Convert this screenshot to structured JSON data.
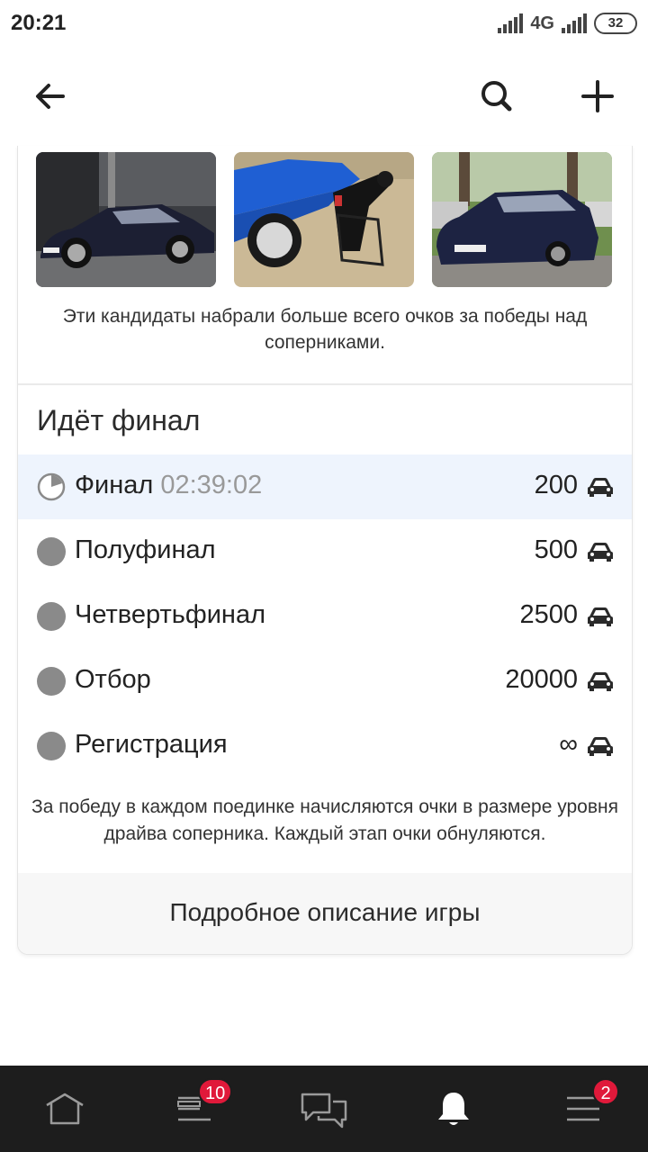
{
  "status_bar": {
    "time": "20:21",
    "network": "4G",
    "battery": "32"
  },
  "app_bar": {
    "icons": [
      "back-arrow-icon",
      "search-icon",
      "plus-icon"
    ]
  },
  "leaders": {
    "photos": [
      {
        "subject": "dark BMW coupe near garage"
      },
      {
        "subject": "blue car with person in chair"
      },
      {
        "subject": "dark BMW sedan in parking"
      }
    ],
    "caption": "Эти кандидаты набрали больше всего очков за победы над соперниками."
  },
  "final_section": {
    "title": "Идёт финал",
    "stages": [
      {
        "name": "Финал",
        "timer": "02:39:02",
        "points": "200",
        "active": true
      },
      {
        "name": "Полуфинал",
        "timer": "",
        "points": "500",
        "active": false
      },
      {
        "name": "Четвертьфинал",
        "timer": "",
        "points": "2500",
        "active": false
      },
      {
        "name": "Отбор",
        "timer": "",
        "points": "20000",
        "active": false
      },
      {
        "name": "Регистрация",
        "timer": "",
        "points": "∞",
        "active": false
      }
    ],
    "rules_text": "За победу в каждом поединке начисляются очки в размере уровня драйва соперника. Каждый этап очки обнуляются.",
    "details_button": "Подробное описание игры"
  },
  "bottom_nav": {
    "items": [
      {
        "icon": "home-icon",
        "badge": ""
      },
      {
        "icon": "feed-icon",
        "badge": "10"
      },
      {
        "icon": "messages-icon",
        "badge": ""
      },
      {
        "icon": "bell-icon",
        "badge": ""
      },
      {
        "icon": "menu-icon",
        "badge": "2"
      }
    ]
  },
  "colors": {
    "active_row": "#eef4fd",
    "badge": "#e0193a",
    "nav_bg": "#1d1d1d",
    "dot": "#8a8a8a"
  }
}
